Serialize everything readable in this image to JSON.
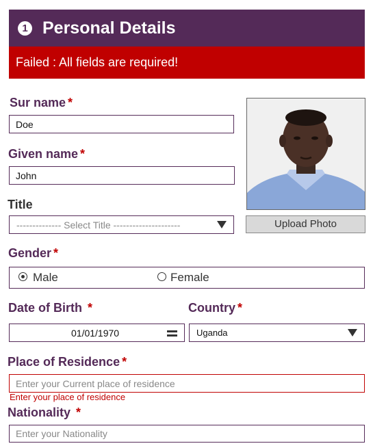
{
  "header": {
    "step": "1",
    "title": "Personal Details"
  },
  "alert": {
    "message": "Failed : All fields are required!"
  },
  "form": {
    "surname": {
      "label": "Sur name",
      "required": "*",
      "value": "Doe"
    },
    "given_name": {
      "label": "Given name",
      "required": "*",
      "value": "John"
    },
    "title": {
      "label": "Title",
      "selected": "-------------- Select Title ---------------------"
    },
    "photo": {
      "upload_label": "Upload Photo"
    },
    "gender": {
      "label": "Gender",
      "required": "*",
      "options": [
        "Male",
        "Female"
      ],
      "selected": "Male"
    },
    "dob": {
      "label": "Date of Birth",
      "required": "*",
      "value": "01/01/1970"
    },
    "country": {
      "label": "Country",
      "required": "*",
      "selected": "Uganda"
    },
    "residence": {
      "label": "Place of Residence",
      "required": "*",
      "placeholder": "Enter your Current place of residence",
      "error": "Enter your place of residence"
    },
    "nationality": {
      "label": "Nationality",
      "required": "*",
      "placeholder": "Enter your Nationality"
    }
  },
  "colors": {
    "primary": "#542a58",
    "error": "#c00000"
  }
}
